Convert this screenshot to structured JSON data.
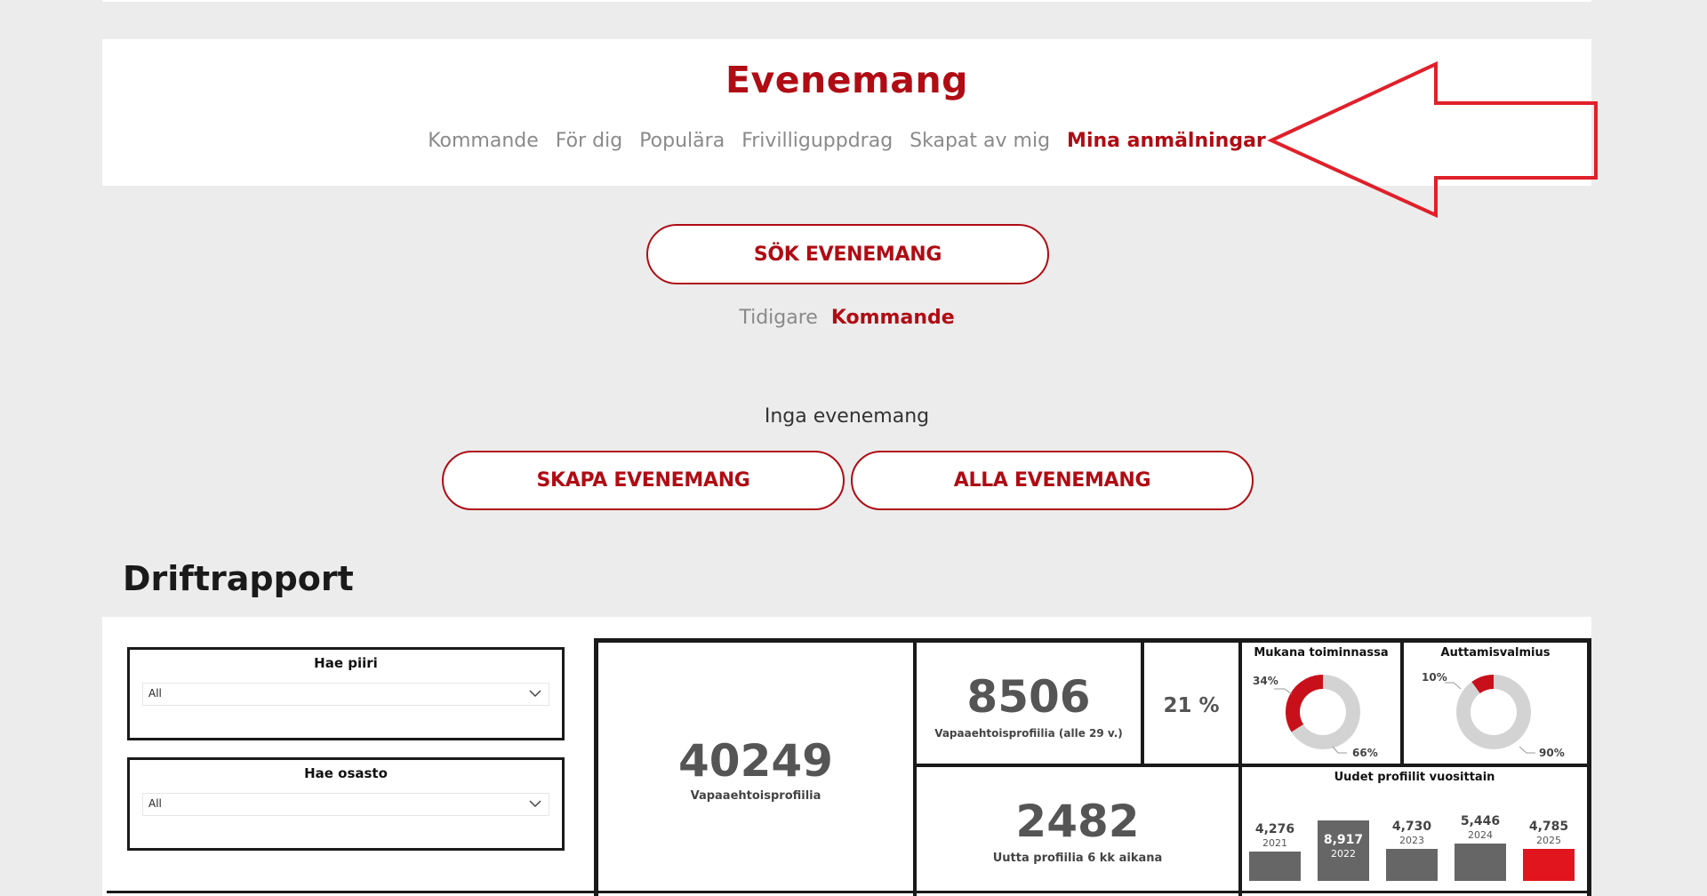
{
  "events": {
    "title": "Evenemang",
    "tabs": [
      {
        "label": "Kommande"
      },
      {
        "label": "För dig"
      },
      {
        "label": "Populära"
      },
      {
        "label": "Frivilliguppdrag"
      },
      {
        "label": "Skapat av mig"
      },
      {
        "label": "Mina anmälningar",
        "active": true
      }
    ],
    "search_button": "SÖK EVENEMANG",
    "period": {
      "past": "Tidigare",
      "upcoming": "Kommande",
      "active": "upcoming"
    },
    "empty_text": "Inga evenemang",
    "create_button": "SKAPA EVENEMANG",
    "all_button": "ALLA EVENEMANG",
    "accent_color": "#b00c14"
  },
  "report": {
    "title": "Driftrapport",
    "slicers": [
      {
        "label": "Hae piiri",
        "value": "All"
      },
      {
        "label": "Hae osasto",
        "value": "All"
      }
    ],
    "kpis": {
      "total_profiles": {
        "value": "40249",
        "label": "Vapaaehtoisprofiilia"
      },
      "young_profiles": {
        "value": "8506",
        "label": "Vapaaehtoisprofiilia (alle 29 v.)"
      },
      "young_share": {
        "value": "21 %"
      },
      "new_profiles": {
        "value": "2482",
        "label": "Uutta profiilia 6 kk aikana"
      }
    },
    "donuts": [
      {
        "title": "Mukana toiminnassa",
        "active_pct": 34,
        "active_label": "34%",
        "rest_label": "66%"
      },
      {
        "title": "Auttamisvalmius",
        "active_pct": 10,
        "active_label": "10%",
        "rest_label": "90%"
      }
    ],
    "yearly": {
      "title": "Uudet profiilit vuosittain",
      "bars": [
        {
          "year": "2021",
          "value": 4276,
          "label": "4,276"
        },
        {
          "year": "2022",
          "value": 8917,
          "label": "8,917"
        },
        {
          "year": "2023",
          "value": 4730,
          "label": "4,730"
        },
        {
          "year": "2024",
          "value": 5446,
          "label": "5,446"
        },
        {
          "year": "2025",
          "value": 4785,
          "label": "4,785",
          "highlight": true
        }
      ]
    }
  }
}
